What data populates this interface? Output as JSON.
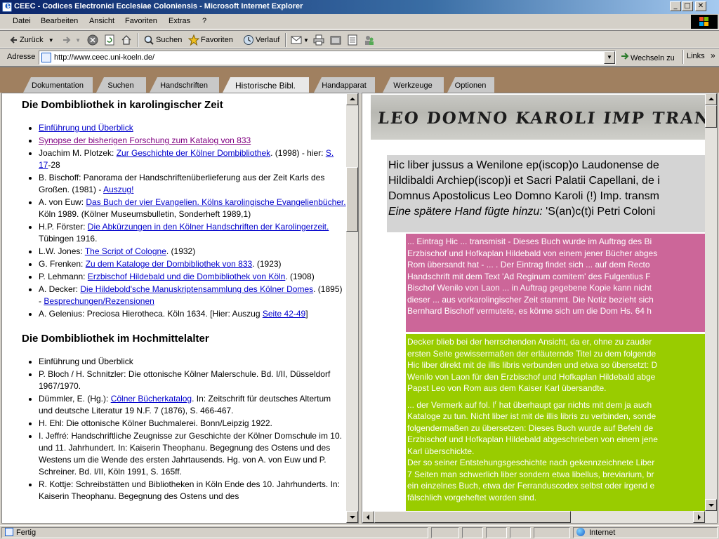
{
  "window": {
    "title": "CEEC - Codices Electronici Ecclesiae Coloniensis - Microsoft Internet Explorer",
    "controls": [
      "_",
      "□",
      "✕"
    ]
  },
  "menu": [
    "Datei",
    "Bearbeiten",
    "Ansicht",
    "Favoriten",
    "Extras",
    "?"
  ],
  "toolbar": {
    "back": "Zurück",
    "search": "Suchen",
    "favorites": "Favoriten",
    "history": "Verlauf"
  },
  "address": {
    "label": "Adresse",
    "url": "http://www.ceec.uni-koeln.de/",
    "go": "Wechseln zu",
    "links": "Links"
  },
  "tabs": [
    "Dokumentation",
    "Suchen",
    "Handschriften",
    "Historische Bibl.",
    "Handapparat",
    "Werkzeuge",
    "Optionen"
  ],
  "active_tab_index": 3,
  "left": {
    "section1_title": "Die Dombibliothek in karolingischer Zeit",
    "section2_title": "Die Dombibliothek im Hochmittelalter",
    "s1": {
      "i1_link": "Einführung und Überblick",
      "i2_link": "Synopse der bisherigen Forschung zum Katalog von 833",
      "i3_pre": "Joachim M. Plotzek: ",
      "i3_link": "Zur Geschichte der Kölner Dombibliothek",
      "i3_mid": ". (1998) - hier: ",
      "i3_link2": "S. 17",
      "i3_post": "-28",
      "i4_pre": "B. Bischoff: Panorama der Handschriftenüberlieferung aus der Zeit Karls des Großen. (1981) - ",
      "i4_link": "Auszug!",
      "i5_pre": "A. von Euw: ",
      "i5_link": "Das Buch der vier Evangelien. Kölns karolingische Evangelienbücher.",
      "i5_post": " Köln 1989. (Kölner Museumsbulletin, Sonderheft 1989,1)",
      "i6_pre": "H.P. Förster: ",
      "i6_link": "Die Abkürzungen in den Kölner Handschriften der Karolingerzeit.",
      "i6_post": " Tübingen 1916.",
      "i7_pre": "L.W. Jones: ",
      "i7_link": "The Script of Cologne",
      "i7_post": ". (1932)",
      "i8_pre": "G. Frenken: ",
      "i8_link": "Zu dem Kataloge der Dombibliothek von 833",
      "i8_post": ". (1923)",
      "i9_pre": "P. Lehmann: ",
      "i9_link": "Erzbischof Hildebald und die Dombibliothek von Köln",
      "i9_post": ". (1908)",
      "i10_pre": "A. Decker: ",
      "i10_link": "Die Hildebold'sche Manuskriptensammlung des Kölner Domes",
      "i10_mid": ". (1895) - ",
      "i10_link2": "Besprechungen/Rezensionen",
      "i11_pre": "A. Gelenius: Preciosa Hierotheca. Köln 1634. [Hier: Auszug ",
      "i11_link": "Seite 42-49",
      "i11_post": "]"
    },
    "s2": {
      "i1": "Einführung und Überblick",
      "i2": "P. Bloch / H. Schnitzler: Die ottonische Kölner Malerschule. Bd. I/II, Düsseldorf 1967/1970.",
      "i3_pre": "Dümmler, E. (Hg.): ",
      "i3_link": "Cölner Bücherkatalog",
      "i3_post": ". In: Zeitschrift für deutsches Altertum und deutsche Literatur 19 N.F. 7 (1876), S. 466-467.",
      "i4": "H. Ehl: Die ottonische Kölner Buchmalerei. Bonn/Leipzig 1922.",
      "i5": "I. Jeffré: Handschriftliche Zeugnisse zur Geschichte der Kölner Domschule im 10. und 11. Jahrhundert. In: Kaiserin Theophanu. Begegnung des Ostens und des Westens um die Wende des ersten Jahrtausends. Hg. von A. von Euw und P. Schreiner. Bd. I/II, Köln 1991, S. 165ff.",
      "i6": "R. Kottje: Schreibstätten und Bibliotheken in Köln Ende des 10. Jahrhunderts. In: Kaiserin Theophanu. Begegnung des Ostens und des"
    }
  },
  "right": {
    "manuscript_text": "LEO DOMNO KAROLI IMP TRANS",
    "latin": [
      "Hic liber jussus a Wenilone ep(iscop)o Laudonense de",
      "Hildibaldi Archiep(iscop)i et Sacri Palatii Capellani, de i",
      "Domnus Apostolicus Leo Domno Karoli (!) Imp. transm"
    ],
    "latin_italic": "Eine spätere Hand fügte hinzu:",
    "latin_last": " 'S(an)c(t)i Petri Coloni",
    "pink": [
      "... Eintrag Hic ... transmisit - Dieses Buch wurde im Auftrag des Bi",
      "Erzbischof und Hofkaplan Hildebald von einem jener Bücher abges",
      "Rom übersandt hat - ... . Der Eintrag findet sich ... auf dem Recto",
      "Handschrift mit dem Text 'Ad Reginum comitem' des Fulgentius F",
      "Bischof Wenilo von Laon ... in Auftrag gegebene Kopie kann nicht",
      "dieser ... aus vorkarolingischer Zeit stammt. Die Notiz bezieht sich",
      "Bernhard Bischoff vermutete, es könne sich um die Dom Hs. 64 h"
    ],
    "green1": [
      "Decker blieb bei der herrschenden Ansicht, da er, ohne zu zauder",
      "ersten Seite gewissermaßen der erläuternde Titel zu dem folgende",
      "Hic liber direkt mit de illis libris verbunden und etwa so übersetzt: D",
      "Wenilo von Laon für den Erzbischof und Hofkaplan Hildebald abge",
      "Papst Leo von Rom aus dem Kaiser Karl übersandte."
    ],
    "green2_pre": "... der Vermerk auf fol. I",
    "green2_sup": "r",
    "green2_post": " hat überhaupt gar nichts mit dem ja auch",
    "green2": [
      "Kataloge zu tun. Nicht liber ist mit de illis libris zu verbinden, sonde",
      "folgendermaßen zu übersetzen: Dieses Buch wurde auf Befehl de",
      "Erzbischof und Hofkaplan Hildebald abgeschrieben von einem jene",
      "Karl überschickte.",
      "Der so seiner Entstehungsgeschichte nach gekennzeichnete Liber",
      "7 Seiten man schwerlich liber sondern etwa libellus, breviarium, br",
      "ein einzelnes Buch, etwa der Ferranduscodex selbst oder irgend e",
      "fälschlich vorgeheftet worden sind."
    ]
  },
  "status": {
    "left": "Fertig",
    "zone": "Internet"
  },
  "colors": {
    "tab_bg": "#a08060",
    "pink_box": "#cc6699",
    "green_box": "#99cc00",
    "link": "#0000cc",
    "visited_link": "#800080"
  }
}
